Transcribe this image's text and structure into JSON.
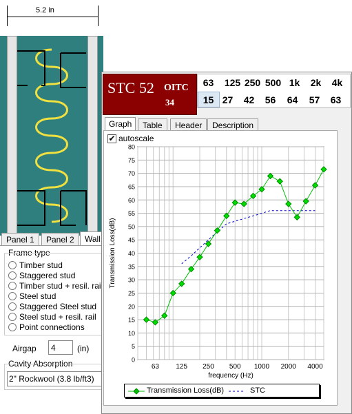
{
  "wall_diagram": {
    "width_label": "5.2 in"
  },
  "stc_box": {
    "stc_label": "STC 52",
    "oitc_label": "OITC",
    "oitc_value": "34"
  },
  "band_table": {
    "frequencies": [
      "63",
      "125",
      "250",
      "500",
      "1k",
      "2k",
      "4k"
    ],
    "values": [
      "15",
      "27",
      "42",
      "56",
      "64",
      "57",
      "63"
    ]
  },
  "left_tabs": [
    "Panel 1",
    "Panel 2",
    "Wall"
  ],
  "frame_type": {
    "title": "Frame type",
    "options": [
      "Timber stud",
      "Staggered stud",
      "Timber stud + resil. rail",
      "Steel stud",
      "Staggered Steel stud",
      "Steel stud + resil. rail",
      "Point connections"
    ]
  },
  "airgap": {
    "label": "Airgap",
    "value": "4",
    "unit": "(in)"
  },
  "cavity": {
    "title": "Cavity Absorption",
    "value": "2\" Rockwool (3.8 lb/ft3)"
  },
  "graph_tabs": [
    "Graph",
    "Table",
    "Header",
    "Description"
  ],
  "autoscale_label": "autoscale",
  "colors": {
    "stc_bg": "#8b0000",
    "teal": "#2f7f7f",
    "series": "#00c000",
    "stc_line": "#0000cc"
  },
  "chart_data": {
    "type": "line",
    "ylabel": "Transmission Loss(dB)",
    "xlabel": "frequency (Hz)",
    "ylim": [
      0,
      80
    ],
    "yticks": [
      0,
      5,
      10,
      15,
      20,
      25,
      30,
      35,
      40,
      45,
      50,
      55,
      60,
      65,
      70,
      75,
      80
    ],
    "xticks": [
      63,
      125,
      250,
      500,
      1000,
      2000,
      4000
    ],
    "xtick_labels": [
      "63",
      "125",
      "250",
      "500",
      "1000",
      "2000",
      "4000"
    ],
    "xlim": [
      40,
      5000
    ],
    "series": [
      {
        "name": "Transmission Loss(dB)",
        "x": [
          50,
          63,
          80,
          100,
          125,
          160,
          200,
          250,
          315,
          400,
          500,
          630,
          800,
          1000,
          1250,
          1600,
          2000,
          2500,
          3150,
          4000,
          5000
        ],
        "values": [
          15,
          14,
          16.5,
          25,
          28.5,
          34,
          38.5,
          43.5,
          48.5,
          54,
          59,
          58.5,
          61.5,
          64,
          69,
          67,
          58.5,
          53.5,
          59.5,
          65.5,
          71.5
        ]
      },
      {
        "name": "STC",
        "x": [
          125,
          160,
          200,
          250,
          315,
          400,
          500,
          630,
          800,
          1000,
          1250,
          1600,
          2000,
          2500,
          3150,
          4000
        ],
        "values": [
          36,
          39,
          42,
          45,
          48,
          51,
          52,
          53,
          54,
          55,
          56,
          56,
          56,
          56,
          56,
          56
        ]
      }
    ],
    "legend": [
      "Transmission Loss(dB)",
      "STC"
    ]
  }
}
